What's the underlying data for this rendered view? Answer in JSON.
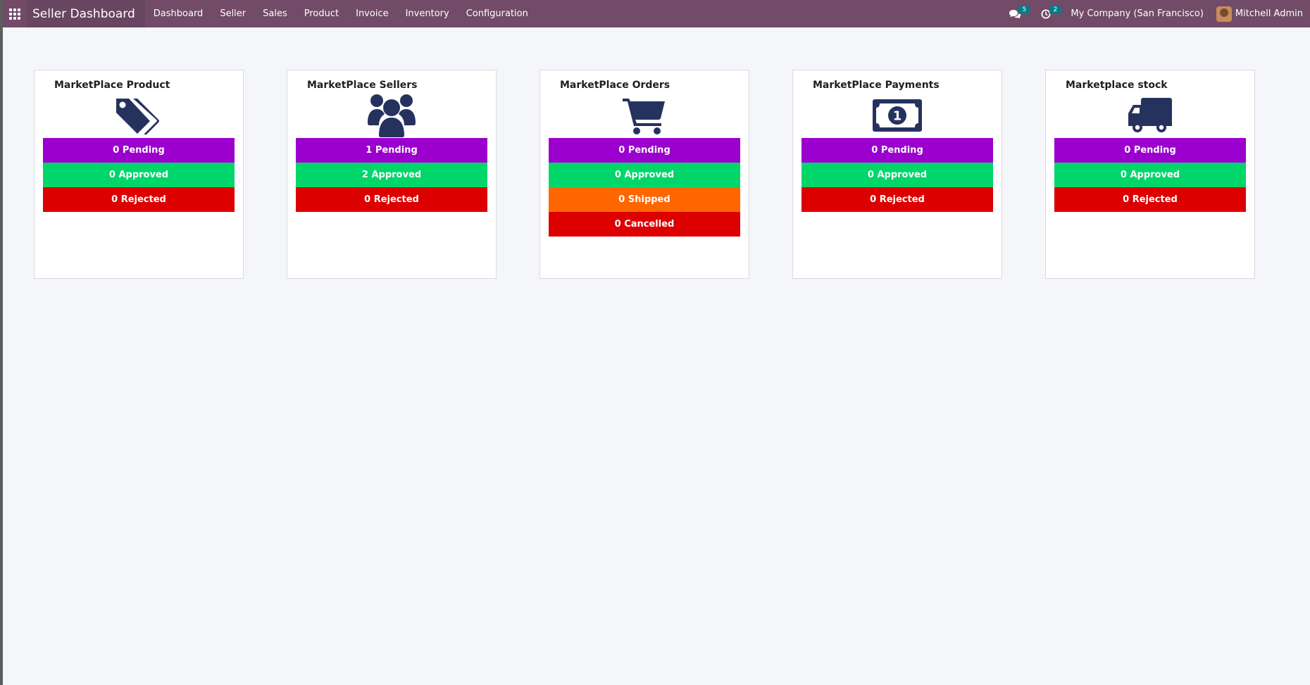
{
  "navbar": {
    "app_title": "Seller Dashboard",
    "menu": [
      "Dashboard",
      "Seller",
      "Sales",
      "Product",
      "Invoice",
      "Inventory",
      "Configuration"
    ],
    "messages_badge": "5",
    "activities_badge": "2",
    "company": "My Company (San Francisco)",
    "user": "Mitchell Admin"
  },
  "colors": {
    "navbar": "#714b67",
    "pending": "#9b00cf",
    "approved": "#00d66a",
    "rejected": "#dd0000",
    "shipped": "#ff6600",
    "icon": "#26325e"
  },
  "cards": [
    {
      "title": "MarketPlace Product",
      "icon": "tags-icon",
      "rows": [
        {
          "label": "0 Pending"
        },
        {
          "label": "0 Approved"
        },
        {
          "label": "0 Rejected"
        }
      ]
    },
    {
      "title": "MarketPlace Sellers",
      "icon": "users-icon",
      "rows": [
        {
          "label": "1 Pending"
        },
        {
          "label": "2 Approved"
        },
        {
          "label": "0 Rejected"
        }
      ]
    },
    {
      "title": "MarketPlace Orders",
      "icon": "shopping-cart-icon",
      "rows": [
        {
          "label": "0 Pending"
        },
        {
          "label": "0 Approved"
        },
        {
          "label": "0 Shipped"
        },
        {
          "label": "0 Cancelled"
        }
      ]
    },
    {
      "title": "MarketPlace Payments",
      "icon": "money-bill-icon",
      "rows": [
        {
          "label": "0 Pending"
        },
        {
          "label": "0 Approved"
        },
        {
          "label": "0 Rejected"
        }
      ]
    },
    {
      "title": "Marketplace stock",
      "icon": "truck-icon",
      "rows": [
        {
          "label": "0 Pending"
        },
        {
          "label": "0 Approved"
        },
        {
          "label": "0 Rejected"
        }
      ]
    }
  ]
}
